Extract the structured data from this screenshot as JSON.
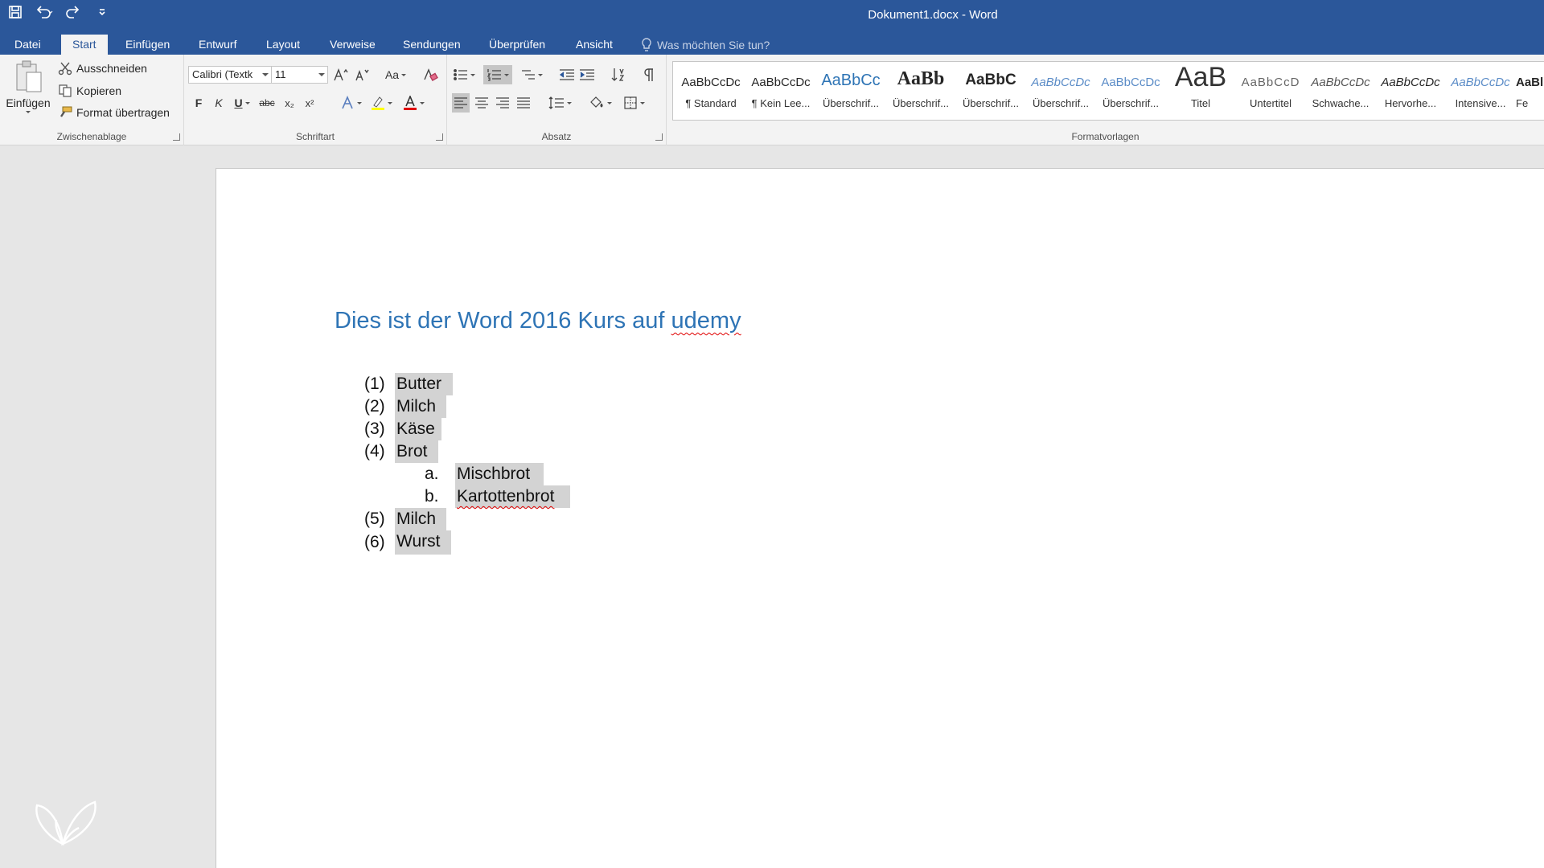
{
  "window": {
    "title": "Dokument1.docx - Word"
  },
  "tabs": [
    "Datei",
    "Start",
    "Einfügen",
    "Entwurf",
    "Layout",
    "Verweise",
    "Sendungen",
    "Überprüfen",
    "Ansicht"
  ],
  "active_tab": "Start",
  "tellme": {
    "placeholder": "Was möchten Sie tun?"
  },
  "clipboard": {
    "paste_label": "Einfügen",
    "cut_label": "Ausschneiden",
    "copy_label": "Kopieren",
    "format_painter_label": "Format übertragen",
    "group_label": "Zwischenablage"
  },
  "font": {
    "family_value": "Calibri (Textk",
    "size_value": "11",
    "bold_label": "F",
    "italic_label": "K",
    "underline_label": "U",
    "strike_label": "abc",
    "sub_label": "x₂",
    "sup_label": "x²",
    "case_label": "Aa",
    "group_label": "Schriftart",
    "highlight_color": "#ffff00",
    "font_color": "#e00000"
  },
  "paragraph": {
    "group_label": "Absatz"
  },
  "styles": {
    "group_label": "Formatvorlagen",
    "items": [
      {
        "sample": "AaBbCcDc",
        "name": "¶ Standard"
      },
      {
        "sample": "AaBbCcDc",
        "name": "¶ Kein Lee..."
      },
      {
        "sample": "AaBbCc",
        "name": "Überschrif..."
      },
      {
        "sample": "AaBb",
        "name": "Überschrif..."
      },
      {
        "sample": "AaBbC",
        "name": "Überschrif..."
      },
      {
        "sample": "AaBbCcDc",
        "name": "Überschrif..."
      },
      {
        "sample": "AaBbCcDc",
        "name": "Überschrif..."
      },
      {
        "sample": "AaB",
        "name": "Titel"
      },
      {
        "sample": "AaBbCcD",
        "name": "Untertitel"
      },
      {
        "sample": "AaBbCcDc",
        "name": "Schwache..."
      },
      {
        "sample": "AaBbCcDc",
        "name": "Hervorhe..."
      },
      {
        "sample": "AaBbCcDc",
        "name": "Intensive..."
      },
      {
        "sample": "AaBl",
        "name": "Fe"
      }
    ]
  },
  "document": {
    "heading_pre": "Dies ist der Word 2016 Kurs auf ",
    "heading_misspelled": "udemy",
    "heading_color": "#2e74b5",
    "list": [
      {
        "marker": "(1)",
        "text": "Butter",
        "level": 1
      },
      {
        "marker": "(2)",
        "text": "Milch",
        "level": 1
      },
      {
        "marker": "(3)",
        "text": "Käse",
        "level": 1
      },
      {
        "marker": "(4)",
        "text": "Brot",
        "level": 1
      },
      {
        "marker": "a.",
        "text": "Mischbrot",
        "level": 2
      },
      {
        "marker": "b.",
        "text": "Kartottenbrot",
        "level": 2,
        "misspelled": true
      },
      {
        "marker": "(5)",
        "text": "Milch",
        "level": 1
      },
      {
        "marker": "(6)",
        "text": "Wurst",
        "level": 1
      }
    ]
  },
  "colors": {
    "accent": "#2b579a",
    "ribbon": "#f3f3f3",
    "selection": "#d3d3d3"
  }
}
